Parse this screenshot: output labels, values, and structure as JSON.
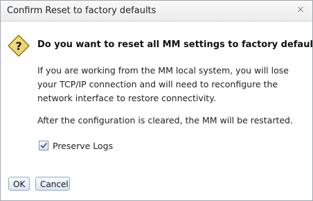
{
  "dialog": {
    "title": "Confirm Reset to factory defaults",
    "close_symbol": "×",
    "icon": "warning-question-icon",
    "question": "Do you want to reset all MM settings to factory defaults?",
    "paragraph1": "If you are working from the MM local system, you will lose your TCP/IP connection and will need to reconfigure the network interface to restore connectivity.",
    "paragraph2": "After the configuration is cleared, the MM will be restarted.",
    "preserve_logs": {
      "label": "Preserve Logs",
      "checked": true
    },
    "buttons": {
      "ok_label": "OK",
      "cancel_label": "Cancel"
    }
  }
}
